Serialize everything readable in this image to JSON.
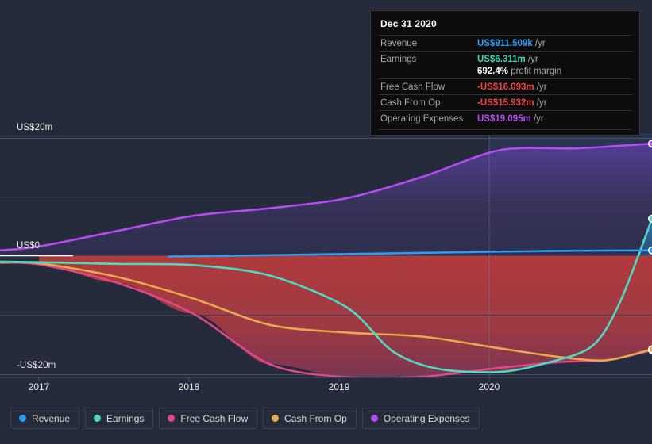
{
  "chart_data": {
    "type": "area",
    "title": "",
    "xlabel": "",
    "ylabel": "",
    "x_ticks": [
      "2017",
      "2018",
      "2019",
      "2020"
    ],
    "y_ticks": [
      "US$20m",
      "US$0",
      "-US$20m"
    ],
    "ylim": [
      -26.5,
      26.5
    ],
    "xlim": [
      2016.74,
      2020.99
    ],
    "grid": true,
    "legend_position": "bottom-left",
    "currency": "USD",
    "units": "millions",
    "series": [
      {
        "name": "Revenue",
        "color": "#2e9bf0",
        "x": [
          2017.84,
          2018.0,
          2018.5,
          2019.0,
          2019.5,
          2020.0,
          2020.5,
          2020.99
        ],
        "values": [
          -0.15,
          -0.1,
          0.1,
          0.3,
          0.5,
          0.7,
          0.85,
          0.912
        ]
      },
      {
        "name": "Earnings",
        "color": "#4fd9c0",
        "x": [
          2016.74,
          2017.0,
          2017.5,
          2018.0,
          2018.5,
          2019.0,
          2019.3,
          2019.6,
          2020.0,
          2020.3,
          2020.6,
          2020.78,
          2020.99
        ],
        "values": [
          -1.0,
          -1.1,
          -1.4,
          -1.6,
          -3.4,
          -8.8,
          -16.3,
          -19.3,
          -19.8,
          -18.3,
          -15.4,
          -8.0,
          6.311
        ]
      },
      {
        "name": "Free Cash Flow",
        "color": "#e0468a",
        "x": [
          2016.74,
          2017.0,
          2017.5,
          2018.0,
          2018.5,
          2019.0,
          2019.5,
          2020.0,
          2020.4,
          2020.7,
          2020.99
        ],
        "values": [
          -1.2,
          -1.5,
          -4.6,
          -9.9,
          -18.5,
          -20.7,
          -20.6,
          -19.1,
          -18.1,
          -17.8,
          -16.093
        ]
      },
      {
        "name": "Cash From Op",
        "color": "#e8a84c",
        "x": [
          2016.74,
          2017.0,
          2017.5,
          2018.0,
          2018.5,
          2019.0,
          2019.5,
          2020.0,
          2020.4,
          2020.7,
          2020.99
        ],
        "values": [
          -1.1,
          -1.3,
          -3.6,
          -7.3,
          -11.8,
          -13.1,
          -13.8,
          -15.8,
          -17.3,
          -17.8,
          -15.932
        ]
      },
      {
        "name": "Operating Expenses",
        "color": "#b44bf0",
        "x": [
          2016.74,
          2017.0,
          2017.5,
          2018.0,
          2018.5,
          2019.0,
          2019.5,
          2020.0,
          2020.5,
          2020.99
        ],
        "values": [
          0.9,
          1.6,
          4.2,
          6.8,
          8.1,
          9.8,
          13.5,
          18.0,
          18.3,
          19.095
        ]
      }
    ]
  },
  "axis": {
    "y_top_label": "US$20m",
    "y_zero_label": "US$0",
    "y_bottom_label": "-US$20m",
    "x_labels": [
      "2017",
      "2018",
      "2019",
      "2020"
    ]
  },
  "tooltip": {
    "date": "Dec 31 2020",
    "rows": [
      {
        "key": "Revenue",
        "value": "US$911.509k",
        "unit": "/yr",
        "color": "#2e9bf0"
      },
      {
        "key": "Earnings",
        "value": "US$6.311m",
        "unit": "/yr",
        "color": "#3ad6b4"
      },
      {
        "key": "",
        "value": "692.4%",
        "unit": "profit margin",
        "color": "#ffffff"
      },
      {
        "key": "Free Cash Flow",
        "value": "-US$16.093m",
        "unit": "/yr",
        "color": "#ef4444"
      },
      {
        "key": "Cash From Op",
        "value": "-US$15.932m",
        "unit": "/yr",
        "color": "#ef4444"
      },
      {
        "key": "Operating Expenses",
        "value": "US$19.095m",
        "unit": "/yr",
        "color": "#b44bf0"
      }
    ]
  },
  "legend": {
    "items": [
      {
        "label": "Revenue",
        "color": "#2e9bf0"
      },
      {
        "label": "Earnings",
        "color": "#4fd9c0"
      },
      {
        "label": "Free Cash Flow",
        "color": "#e0468a"
      },
      {
        "label": "Cash From Op",
        "color": "#e8a84c"
      },
      {
        "label": "Operating Expenses",
        "color": "#b44bf0"
      }
    ]
  }
}
